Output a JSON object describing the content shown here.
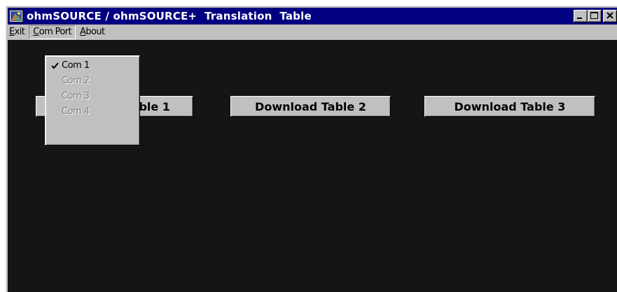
{
  "window": {
    "title": "ohmSOURCE / ohmSOURCE+  Translation  Table",
    "icon": "app-icon"
  },
  "title_buttons": {
    "minimize_icon": "minimize-icon",
    "maximize_icon": "maximize-icon",
    "close_icon": "close-icon"
  },
  "menubar": {
    "exit": {
      "accel": "E",
      "rest": "xit"
    },
    "com_port": {
      "accel": "C",
      "rest": "om Port"
    },
    "about": {
      "accel": "A",
      "rest": "bout"
    }
  },
  "com_port_menu": {
    "items": [
      {
        "label": "Com 1",
        "checked": true,
        "enabled": true
      },
      {
        "label": "Com 2",
        "checked": false,
        "enabled": false
      },
      {
        "label": "Com 3",
        "checked": false,
        "enabled": false
      },
      {
        "label": "Com 4",
        "checked": false,
        "enabled": false
      }
    ]
  },
  "buttons": {
    "download_1": "Download Table 1",
    "download_2": "Download Table 2",
    "download_3": "Download Table 3"
  },
  "colors": {
    "titlebar": "#000080",
    "client_background": "#151515",
    "face": "#c0c0c0"
  }
}
